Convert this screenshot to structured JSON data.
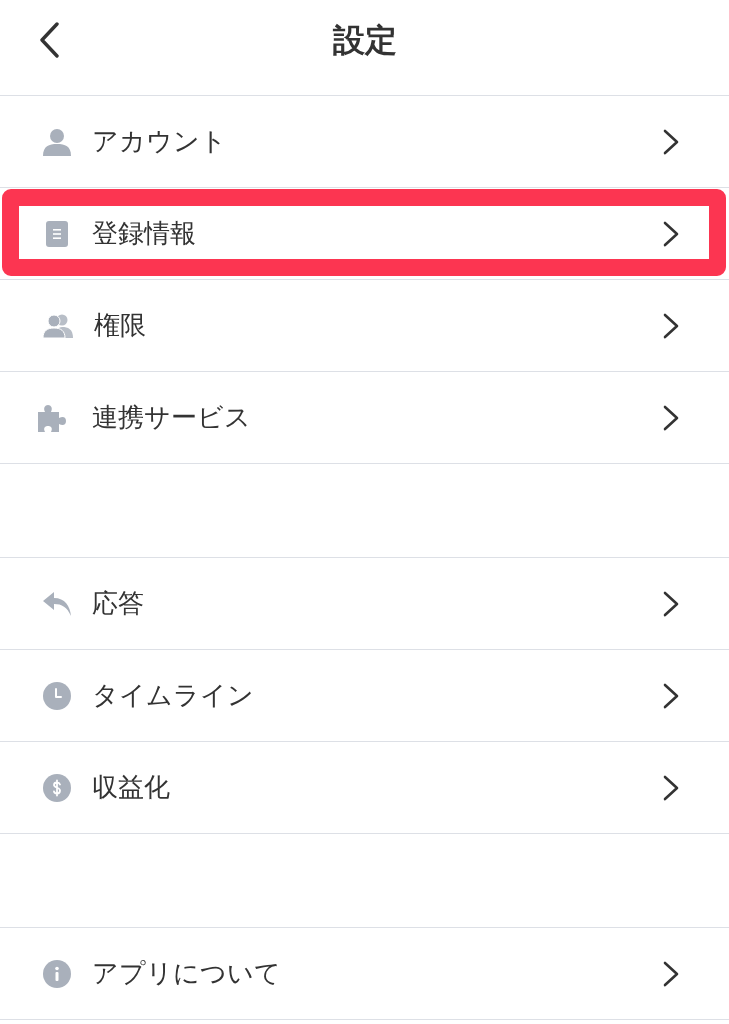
{
  "header": {
    "title": "設定"
  },
  "sections": [
    {
      "items": [
        {
          "label": "アカウント",
          "highlighted": false
        },
        {
          "label": "登録情報",
          "highlighted": true
        },
        {
          "label": "権限",
          "highlighted": false
        },
        {
          "label": "連携サービス",
          "highlighted": false
        }
      ]
    },
    {
      "items": [
        {
          "label": "応答",
          "highlighted": false
        },
        {
          "label": "タイムライン",
          "highlighted": false
        },
        {
          "label": "収益化",
          "highlighted": false
        }
      ]
    },
    {
      "items": [
        {
          "label": "アプリについて",
          "highlighted": false
        }
      ]
    }
  ]
}
